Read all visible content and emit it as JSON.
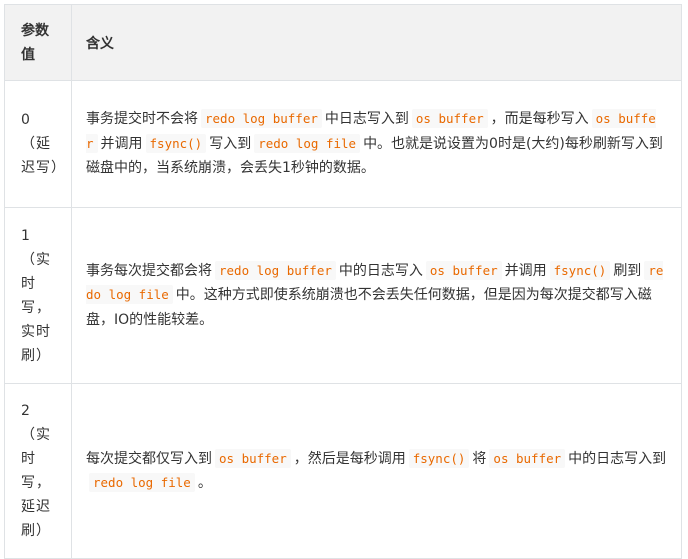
{
  "table": {
    "headers": {
      "value": "参数值",
      "meaning": "含义"
    },
    "rows": [
      {
        "value": "0（延迟写）",
        "meaning": [
          {
            "t": "text",
            "v": "事务提交时不会将"
          },
          {
            "t": "code",
            "v": "redo log buffer"
          },
          {
            "t": "text",
            "v": "中日志写入到"
          },
          {
            "t": "code",
            "v": "os buffer"
          },
          {
            "t": "text",
            "v": "，而是每秒写入"
          },
          {
            "t": "code",
            "v": "os buffer"
          },
          {
            "t": "text",
            "v": "并调用"
          },
          {
            "t": "code",
            "v": "fsync()"
          },
          {
            "t": "text",
            "v": "写入到"
          },
          {
            "t": "code",
            "v": "redo log file"
          },
          {
            "t": "text",
            "v": "中。也就是说设置为0时是(大约)每秒刷新写入到磁盘中的，当系统崩溃，会丢失1秒钟的数据。"
          }
        ]
      },
      {
        "value": "1（实时写，实时刷）",
        "meaning": [
          {
            "t": "text",
            "v": "事务每次提交都会将"
          },
          {
            "t": "code",
            "v": "redo log buffer"
          },
          {
            "t": "text",
            "v": "中的日志写入"
          },
          {
            "t": "code",
            "v": "os buffer"
          },
          {
            "t": "text",
            "v": "并调用"
          },
          {
            "t": "code",
            "v": "fsync()"
          },
          {
            "t": "text",
            "v": "刷到"
          },
          {
            "t": "code",
            "v": "redo log file"
          },
          {
            "t": "text",
            "v": "中。这种方式即使系统崩溃也不会丢失任何数据，但是因为每次提交都写入磁盘，IO的性能较差。"
          }
        ]
      },
      {
        "value": "2（实时写，延迟刷）",
        "meaning": [
          {
            "t": "text",
            "v": "每次提交都仅写入到"
          },
          {
            "t": "code",
            "v": "os buffer"
          },
          {
            "t": "text",
            "v": "，然后是每秒调用"
          },
          {
            "t": "code",
            "v": "fsync()"
          },
          {
            "t": "text",
            "v": "将"
          },
          {
            "t": "code",
            "v": "os buffer"
          },
          {
            "t": "text",
            "v": "中的日志写入到"
          },
          {
            "t": "code",
            "v": "redo log file"
          },
          {
            "t": "text",
            "v": "。"
          }
        ]
      }
    ]
  }
}
